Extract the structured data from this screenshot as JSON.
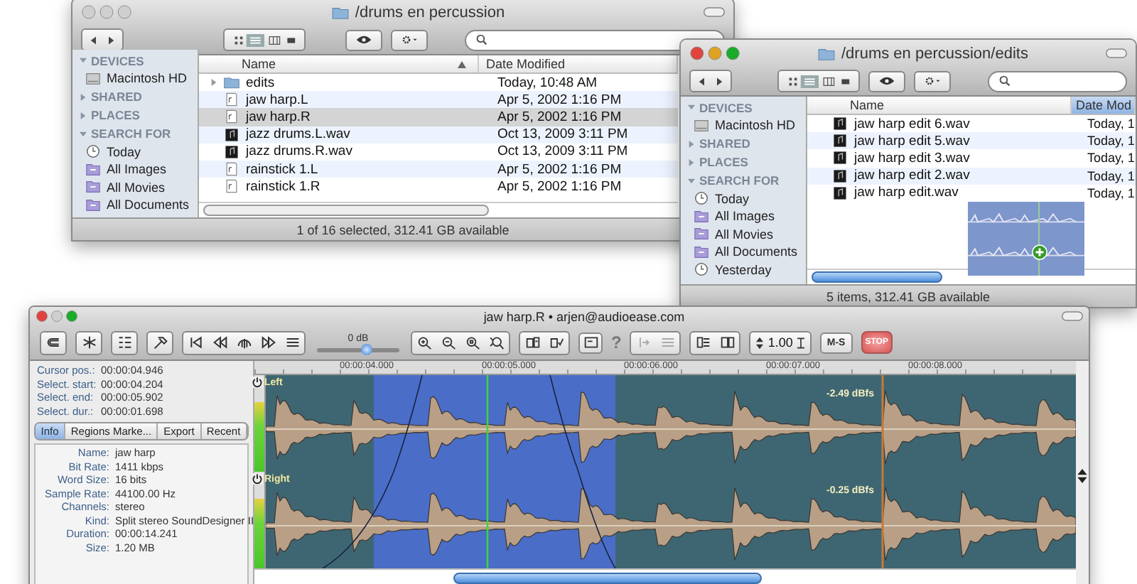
{
  "finder_back": {
    "title": "/drums en percussion",
    "active": false,
    "sidebar": [
      {
        "label": "DEVICES",
        "expanded": true,
        "children": [
          {
            "label": "Macintosh HD",
            "kind": "disk"
          }
        ]
      },
      {
        "label": "SHARED",
        "expanded": false
      },
      {
        "label": "PLACES",
        "expanded": false
      },
      {
        "label": "SEARCH FOR",
        "expanded": true,
        "children": [
          {
            "label": "Today",
            "kind": "clock"
          },
          {
            "label": "All Images",
            "kind": "smart"
          },
          {
            "label": "All Movies",
            "kind": "smart"
          },
          {
            "label": "All Documents",
            "kind": "smart"
          }
        ]
      }
    ],
    "columns": [
      {
        "label": "Name",
        "sorted": true
      },
      {
        "label": "Date Modified",
        "sorted": false
      }
    ],
    "rows": [
      {
        "name": "edits",
        "date": "Today, 10:48 AM",
        "kind": "folder",
        "selected": false
      },
      {
        "name": "jaw harp.L",
        "date": "Apr 5, 2002 1:16 PM",
        "kind": "doc",
        "selected": false
      },
      {
        "name": "jaw harp.R",
        "date": "Apr 5, 2002 1:16 PM",
        "kind": "doc",
        "selected": true
      },
      {
        "name": "jazz drums.L.wav",
        "date": "Oct 13, 2009 3:11 PM",
        "kind": "audio",
        "selected": false
      },
      {
        "name": "jazz drums.R.wav",
        "date": "Oct 13, 2009 3:11 PM",
        "kind": "audio",
        "selected": false
      },
      {
        "name": "rainstick 1.L",
        "date": "Apr 5, 2002 1:16 PM",
        "kind": "doc",
        "selected": false
      },
      {
        "name": "rainstick 1.R",
        "date": "Apr 5, 2002 1:16 PM",
        "kind": "doc",
        "selected": false
      }
    ],
    "status": "1 of 16 selected, 312.41 GB available"
  },
  "finder_front": {
    "title": "/drums en percussion/edits",
    "active": true,
    "sidebar": [
      {
        "label": "DEVICES",
        "expanded": true,
        "children": [
          {
            "label": "Macintosh HD",
            "kind": "disk"
          }
        ]
      },
      {
        "label": "SHARED",
        "expanded": false
      },
      {
        "label": "PLACES",
        "expanded": false
      },
      {
        "label": "SEARCH FOR",
        "expanded": true,
        "children": [
          {
            "label": "Today",
            "kind": "clock"
          },
          {
            "label": "All Images",
            "kind": "smart"
          },
          {
            "label": "All Movies",
            "kind": "smart"
          },
          {
            "label": "All Documents",
            "kind": "smart"
          },
          {
            "label": "Yesterday",
            "kind": "clock"
          }
        ]
      }
    ],
    "columns": [
      {
        "label": "Name",
        "sorted": false
      },
      {
        "label": "Date Mod",
        "sorted": true
      }
    ],
    "rows": [
      {
        "name": "jaw harp edit 6.wav",
        "date": "Today, 1",
        "kind": "audio",
        "selected": false
      },
      {
        "name": "jaw harp edit 5.wav",
        "date": "Today, 1",
        "kind": "audio",
        "selected": false
      },
      {
        "name": "jaw harp edit 3.wav",
        "date": "Today, 1",
        "kind": "audio",
        "selected": false
      },
      {
        "name": "jaw harp edit 2.wav",
        "date": "Today, 1",
        "kind": "audio",
        "selected": false
      },
      {
        "name": "jaw harp edit.wav",
        "date": "Today, 1",
        "kind": "audio",
        "selected": false
      }
    ],
    "status": "5 items, 312.41 GB available"
  },
  "editor": {
    "title": "jaw harp.R • arjen@audioease.com",
    "active": true,
    "volume": {
      "label": "0 dB",
      "level": 0.6
    },
    "help": "?",
    "zoom_value": "1.00",
    "ms_button": "M-S",
    "stop_button": "STOP",
    "readouts": [
      {
        "label": "Cursor pos.:",
        "value": "00:00:04.946"
      },
      {
        "label": "Select. start:",
        "value": "00:00:04.204"
      },
      {
        "label": "Select. end:",
        "value": "00:00:05.902"
      },
      {
        "label": "Select. dur.:",
        "value": "00:00:01.698"
      }
    ],
    "tabs": [
      {
        "label": "Info",
        "selected": true
      },
      {
        "label": "Regions Marke...",
        "selected": false
      },
      {
        "label": "Export",
        "selected": false
      },
      {
        "label": "Recent",
        "selected": false
      }
    ],
    "info": [
      {
        "label": "Name:",
        "value": "jaw harp"
      },
      {
        "label": "Bit Rate:",
        "value": "1411 kbps"
      },
      {
        "label": "Word Size:",
        "value": "16 bits"
      },
      {
        "label": "Sample Rate:",
        "value": "44100.00 Hz"
      },
      {
        "label": "Channels:",
        "value": "stereo"
      },
      {
        "label": "Kind:",
        "value": "Split stereo SoundDesigner II"
      },
      {
        "label": "Duration:",
        "value": "00:00:14.241"
      },
      {
        "label": "Size:",
        "value": "1.20 MB"
      }
    ],
    "ruler": [
      "00:00:04.000",
      "00:00:05.000",
      "00:00:06.000",
      "00:00:07.000",
      "00:00:08.000"
    ],
    "tracks": [
      {
        "name": "Left",
        "peak": "-2.49 dBfs",
        "level": 0.72
      },
      {
        "name": "Right",
        "peak": "-0.25 dBfs",
        "level": 0.72
      }
    ]
  }
}
